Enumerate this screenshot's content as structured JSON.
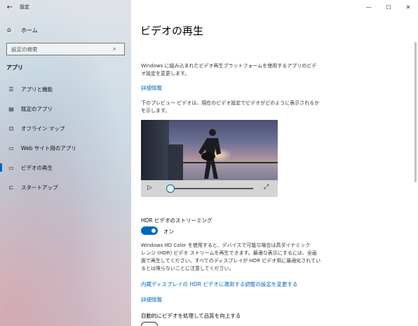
{
  "window": {
    "app_title": "設定",
    "back_icon": "back-arrow-icon",
    "controls": {
      "minimize": "—",
      "maximize": "☐",
      "close": "✕"
    }
  },
  "sidebar": {
    "home_label": "ホーム",
    "search_placeholder": "設定の検索",
    "section_title": "アプリ",
    "items": [
      {
        "label": "アプリと機能",
        "icon": "list-icon",
        "glyph": "☰",
        "active": false
      },
      {
        "label": "既定のアプリ",
        "icon": "default-apps-icon",
        "glyph": "▤",
        "active": false
      },
      {
        "label": "オフライン マップ",
        "icon": "map-icon",
        "glyph": "⊡",
        "active": false
      },
      {
        "label": "Web サイト用のアプリ",
        "icon": "web-apps-icon",
        "glyph": "▭",
        "active": false
      },
      {
        "label": "ビデオの再生",
        "icon": "video-icon",
        "glyph": "▭",
        "active": true
      },
      {
        "label": "スタートアップ",
        "icon": "startup-icon",
        "glyph": "⊏",
        "active": false
      }
    ]
  },
  "main": {
    "title": "ビデオの再生",
    "intro_line1": "Windows に組み込まれたビデオ再生プラットフォームを使用するアプリのビデ",
    "intro_line2": "オ設定を変更します。",
    "details_link_1": "詳細情報",
    "preview_line1": "下のプレビュー ビデオは、現在のビデオ設定でビデオがどのように表示されるか",
    "preview_line2": "を示します。",
    "video_play_icon": "play-icon",
    "video_fullscreen_icon": "fullscreen-icon",
    "video_progress": 0.0,
    "hdr_title": "HDR ビデオのストリーミング",
    "hdr_toggle_label": "オン",
    "hdr_toggle_on": true,
    "hdr_desc_line1": "Windows HD Color を使用すると、デバイスで可能な場合は高ダイナミック",
    "hdr_desc_line2": "レンジ (HDR) ビデオ ストリームを再生できます。最適な表示にするには、全画",
    "hdr_desc_line3": "面で再生してください。すべてのディスプレイが HDR ビデオ用に最適化されてい",
    "hdr_desc_line4": "るとは限らないことに注意してください。",
    "hdr_settings_link": "内蔵ディスプレイの HDR ビデオに適用する調整の設定を変更する",
    "details_link_2": "詳細情報",
    "auto_process_title": "自動的にビデオを処理して品質を向上する"
  },
  "colors": {
    "accent": "#0067c0"
  }
}
